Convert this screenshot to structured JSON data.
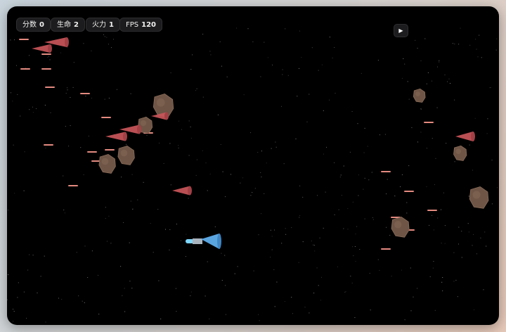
{
  "hud": {
    "score_label": "分数",
    "score_value": "0",
    "lives_label": "生命",
    "lives_value": "2",
    "firepower_label": "火力",
    "firepower_value": "1",
    "fps_label": "FPS",
    "fps_value": "120"
  },
  "controls": {
    "play_icon": "▶"
  },
  "colors": {
    "background": "#000000",
    "enemy": "#c9565a",
    "enemy_bullet": "#e58a80",
    "asteroid": "#6e5546",
    "player_body": "#5aa5e0",
    "player_flame": "#7fd7ff",
    "star": "#8a8a8a"
  }
}
